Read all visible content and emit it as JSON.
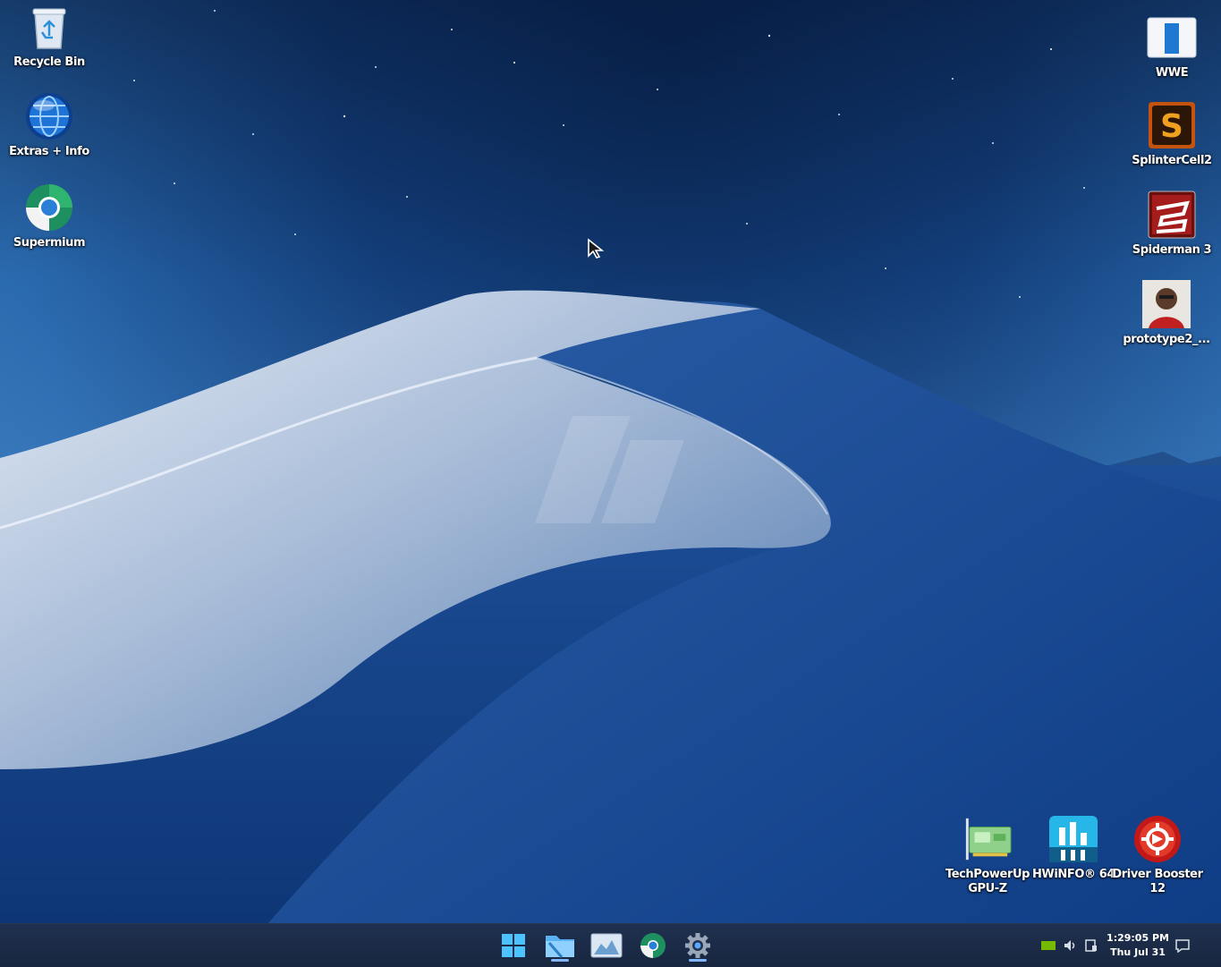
{
  "desktop": {
    "left_icons": [
      {
        "label": "Recycle Bin",
        "icon": "recycle-bin-icon"
      },
      {
        "label": "Extras + Info",
        "icon": "globe-info-icon"
      },
      {
        "label": "Supermium",
        "icon": "supermium-browser-icon"
      }
    ],
    "right_icons": [
      {
        "label": "WWE",
        "icon": "wwe-game-icon"
      },
      {
        "label": "SplinterCell2",
        "icon": "splinter-cell-icon"
      },
      {
        "label": "Spiderman 3",
        "icon": "spiderman-icon"
      },
      {
        "label": "prototype2_...",
        "icon": "prototype-game-icon"
      }
    ],
    "bottom_icons": [
      {
        "label": "TechPowerUp GPU-Z",
        "line1": "TechPowerUp",
        "line2": "GPU-Z",
        "icon": "gpu-card-icon"
      },
      {
        "label": "HWiNFO® 64",
        "line1": "HWiNFO® 64",
        "line2": "",
        "icon": "hwinfo-icon"
      },
      {
        "label": "Driver Booster 12",
        "line1": "Driver Booster",
        "line2": "12",
        "icon": "driver-booster-icon"
      }
    ]
  },
  "taskbar": {
    "pinned": [
      {
        "name": "start-button",
        "icon": "windows-logo-icon"
      },
      {
        "name": "file-explorer-button",
        "icon": "folder-icon",
        "active": true
      },
      {
        "name": "photos-button",
        "icon": "photos-icon"
      },
      {
        "name": "supermium-taskbar-button",
        "icon": "supermium-browser-icon"
      },
      {
        "name": "settings-button",
        "icon": "gear-icon",
        "active": true
      }
    ],
    "clock": {
      "time": "1:29:05 PM",
      "date": "Thu Jul 31"
    }
  },
  "colors": {
    "taskbar_bg": "#1c2d4a",
    "accent": "#7fb8ff",
    "sky_dark": "#0a2a5a",
    "dune_light": "#c9d6ea"
  }
}
